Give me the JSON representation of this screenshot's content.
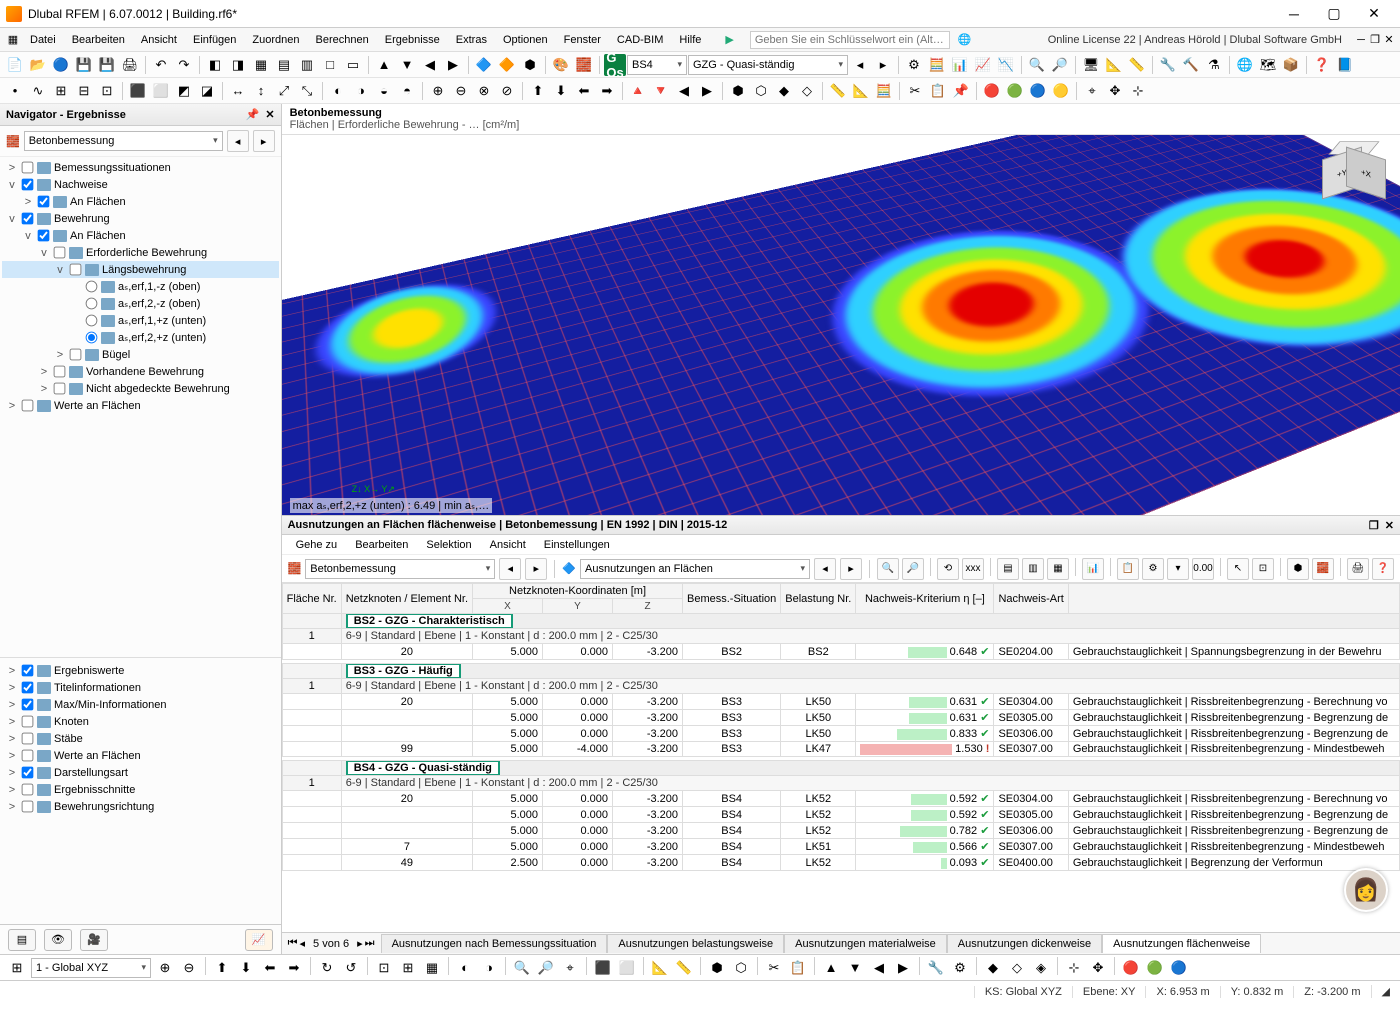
{
  "app": {
    "title": "Dlubal RFEM | 6.07.0012 | Building.rf6*"
  },
  "menu": [
    "Datei",
    "Bearbeiten",
    "Ansicht",
    "Einfügen",
    "Zuordnen",
    "Berechnen",
    "Ergebnisse",
    "Extras",
    "Optionen",
    "Fenster",
    "CAD-BIM",
    "Hilfe"
  ],
  "search_ph": "Geben Sie ein Schlüsselwort ein (Alt…",
  "license": "Online License 22 | Andreas Hörold | Dlubal Software GmbH",
  "gos": "G Os",
  "combo_bs": "BS4",
  "combo_gzg": "GZG - Quasi-ständig",
  "navigator": {
    "title": "Navigator - Ergebnisse",
    "dd": "Betonbemessung",
    "tree": [
      {
        "ind": 0,
        "exp": ">",
        "chk": false,
        "lbl": "Bemessungssituationen"
      },
      {
        "ind": 0,
        "exp": "v",
        "chk": true,
        "lbl": "Nachweise"
      },
      {
        "ind": 1,
        "exp": ">",
        "chk": true,
        "lbl": "An Flächen"
      },
      {
        "ind": 0,
        "exp": "v",
        "chk": true,
        "lbl": "Bewehrung"
      },
      {
        "ind": 1,
        "exp": "v",
        "chk": true,
        "lbl": "An Flächen"
      },
      {
        "ind": 2,
        "exp": "v",
        "chk": false,
        "lbl": "Erforderliche Bewehrung"
      },
      {
        "ind": 3,
        "exp": "v",
        "chk": false,
        "lbl": "Längsbewehrung",
        "sel": true
      },
      {
        "ind": 4,
        "radio": true,
        "rsel": false,
        "lbl": "aₛ,erf,1,-z (oben)"
      },
      {
        "ind": 4,
        "radio": true,
        "rsel": false,
        "lbl": "aₛ,erf,2,-z (oben)"
      },
      {
        "ind": 4,
        "radio": true,
        "rsel": false,
        "lbl": "aₛ,erf,1,+z (unten)"
      },
      {
        "ind": 4,
        "radio": true,
        "rsel": true,
        "lbl": "aₛ,erf,2,+z (unten)"
      },
      {
        "ind": 3,
        "exp": ">",
        "chk": false,
        "lbl": "Bügel"
      },
      {
        "ind": 2,
        "exp": ">",
        "chk": false,
        "lbl": "Vorhandene Bewehrung"
      },
      {
        "ind": 2,
        "exp": ">",
        "chk": false,
        "lbl": "Nicht abgedeckte Bewehrung"
      },
      {
        "ind": 0,
        "exp": ">",
        "chk": false,
        "lbl": "Werte an Flächen"
      }
    ],
    "lower": [
      {
        "chk": true,
        "lbl": "Ergebniswerte"
      },
      {
        "chk": true,
        "lbl": "Titelinformationen"
      },
      {
        "chk": true,
        "lbl": "Max/Min-Informationen"
      },
      {
        "chk": false,
        "lbl": "Knoten"
      },
      {
        "chk": false,
        "lbl": "Stäbe"
      },
      {
        "chk": false,
        "lbl": "Werte an Flächen"
      },
      {
        "chk": true,
        "lbl": "Darstellungsart"
      },
      {
        "chk": false,
        "lbl": "Ergebnisschnitte"
      },
      {
        "chk": false,
        "lbl": "Bewehrungsrichtung"
      }
    ]
  },
  "viewport": {
    "title": "Betonbemessung",
    "sub": "Flächen | Erforderliche Bewehrung - …  [cm²/m]",
    "footer": "max aₛ,erf,2,+z (unten) : 6.49 | min aₛ,… "
  },
  "panel": {
    "title": "Ausnutzungen an Flächen flächenweise | Betonbemessung | EN 1992 | DIN | 2015-12",
    "menu": [
      "Gehe zu",
      "Bearbeiten",
      "Selektion",
      "Ansicht",
      "Einstellungen"
    ],
    "dd1": "Betonbemessung",
    "dd2": "Ausnutzungen an Flächen",
    "cols": [
      "Fläche Nr.",
      "Netzknoten / Element Nr.",
      "X",
      "Y",
      "Z",
      "Bemess.-Situation",
      "Belastung Nr.",
      "Nachweis-Kriterium η [–]",
      "Nachweis-Art",
      ""
    ],
    "colgroup": "Netzknoten-Koordinaten [m]",
    "groups": [
      {
        "hdr": "BS2 - GZG - Charakteristisch",
        "info": "6-9 | Standard | Ebene | 1 - Konstant | d : 200.0 mm | 2 - C25/30",
        "no": "1",
        "rows": [
          {
            "n": "20",
            "x": "5.000",
            "y": "0.000",
            "z": "-3.200",
            "bs": "BS2",
            "lk": "BS2",
            "eta": "0.648",
            "ok": true,
            "code": "SE0204.00",
            "art": "Gebrauchstauglichkeit | Spannungsbegrenzung in der Bewehru"
          }
        ]
      },
      {
        "hdr": "BS3 - GZG - Häufig",
        "info": "6-9 | Standard | Ebene | 1 - Konstant | d : 200.0 mm | 2 - C25/30",
        "no": "1",
        "rows": [
          {
            "n": "20",
            "x": "5.000",
            "y": "0.000",
            "z": "-3.200",
            "bs": "BS3",
            "lk": "LK50",
            "eta": "0.631",
            "ok": true,
            "code": "SE0304.00",
            "art": "Gebrauchstauglichkeit | Rissbreitenbegrenzung - Berechnung vo"
          },
          {
            "n": "",
            "x": "5.000",
            "y": "0.000",
            "z": "-3.200",
            "bs": "BS3",
            "lk": "LK50",
            "eta": "0.631",
            "ok": true,
            "code": "SE0305.00",
            "art": "Gebrauchstauglichkeit | Rissbreitenbegrenzung - Begrenzung de"
          },
          {
            "n": "",
            "x": "5.000",
            "y": "0.000",
            "z": "-3.200",
            "bs": "BS3",
            "lk": "LK50",
            "eta": "0.833",
            "ok": true,
            "code": "SE0306.00",
            "art": "Gebrauchstauglichkeit | Rissbreitenbegrenzung - Begrenzung de"
          },
          {
            "n": "99",
            "x": "5.000",
            "y": "-4.000",
            "z": "-3.200",
            "bs": "BS3",
            "lk": "LK47",
            "eta": "1.530",
            "ok": false,
            "code": "SE0307.00",
            "art": "Gebrauchstauglichkeit | Rissbreitenbegrenzung - Mindestbeweh"
          }
        ]
      },
      {
        "hdr": "BS4 - GZG - Quasi-ständig",
        "info": "6-9 | Standard | Ebene | 1 - Konstant | d : 200.0 mm | 2 - C25/30",
        "no": "1",
        "rows": [
          {
            "n": "20",
            "x": "5.000",
            "y": "0.000",
            "z": "-3.200",
            "bs": "BS4",
            "lk": "LK52",
            "eta": "0.592",
            "ok": true,
            "code": "SE0304.00",
            "art": "Gebrauchstauglichkeit | Rissbreitenbegrenzung - Berechnung vo"
          },
          {
            "n": "",
            "x": "5.000",
            "y": "0.000",
            "z": "-3.200",
            "bs": "BS4",
            "lk": "LK52",
            "eta": "0.592",
            "ok": true,
            "code": "SE0305.00",
            "art": "Gebrauchstauglichkeit | Rissbreitenbegrenzung - Begrenzung de"
          },
          {
            "n": "",
            "x": "5.000",
            "y": "0.000",
            "z": "-3.200",
            "bs": "BS4",
            "lk": "LK52",
            "eta": "0.782",
            "ok": true,
            "code": "SE0306.00",
            "art": "Gebrauchstauglichkeit | Rissbreitenbegrenzung - Begrenzung de"
          },
          {
            "n": "7",
            "x": "5.000",
            "y": "0.000",
            "z": "-3.200",
            "bs": "BS4",
            "lk": "LK51",
            "eta": "0.566",
            "ok": true,
            "code": "SE0307.00",
            "art": "Gebrauchstauglichkeit | Rissbreitenbegrenzung - Mindestbeweh"
          },
          {
            "n": "49",
            "x": "2.500",
            "y": "0.000",
            "z": "-3.200",
            "bs": "BS4",
            "lk": "LK52",
            "eta": "0.093",
            "ok": true,
            "code": "SE0400.00",
            "art": "Gebrauchstauglichkeit | Begrenzung der Verformun"
          }
        ]
      }
    ],
    "page": "5 von 6",
    "tabs": [
      "Ausnutzungen nach Bemessungssituation",
      "Ausnutzungen belastungsweise",
      "Ausnutzungen materialweise",
      "Ausnutzungen dickenweise",
      "Ausnutzungen flächenweise"
    ],
    "active_tab": 4
  },
  "bstatus": {
    "cs": "1 - Global XYZ",
    "ks": "KS: Global XYZ",
    "ebene": "Ebene: XY",
    "x": "X: 6.953 m",
    "y": "Y: 0.832 m",
    "z": "Z: -3.200 m"
  }
}
